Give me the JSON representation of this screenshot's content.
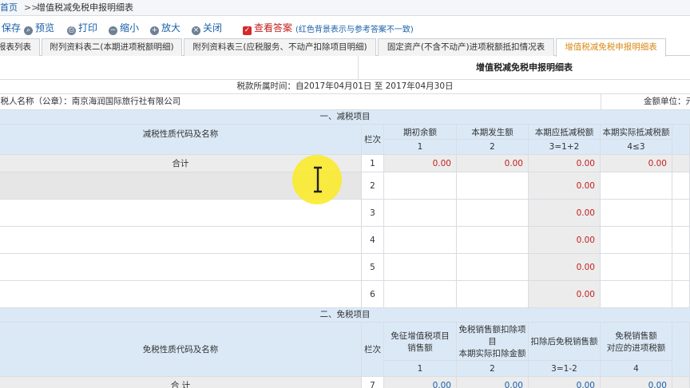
{
  "breadcrumb": {
    "home": "首页",
    "separator": ">>",
    "current": "增值税减免税申报明细表"
  },
  "toolbar": {
    "save": "保存",
    "preview": "预览",
    "print": "打印",
    "zoom_out": "缩小",
    "zoom_in": "放大",
    "close": "关闭",
    "answer": "查看答案",
    "answer_note": "(红色背景表示与参考答案不一致)"
  },
  "tabs": [
    {
      "label": "报表列表"
    },
    {
      "label": "附列资料表二(本期进项税额明细)"
    },
    {
      "label": "附列资料表三(应税服务、不动产扣除项目明细)"
    },
    {
      "label": "固定资产(不含不动产)进项税额抵扣情况表"
    },
    {
      "label": "增值税减免税申报明细表",
      "active": true
    }
  ],
  "form": {
    "title": "增值税减免税申报明细表",
    "period": "税款所属时间：自2017年04月01日 至 2017年04月30日",
    "payer": "纳税人名称（公章）：南京海润国际旅行社有限公司",
    "unit": "金额单位：元"
  },
  "section1": {
    "title": "一、减税项目",
    "col_name": "减税性质代码及名称",
    "col_seq": "栏次",
    "headers": [
      "期初余额",
      "本期发生额",
      "本期应抵减税额",
      "本期实际抵减税额"
    ],
    "codes": [
      "1",
      "2",
      "3=1+2",
      "4≤3"
    ],
    "total": {
      "label": "合计",
      "seq": "1",
      "values": [
        "0.00",
        "0.00",
        "0.00",
        "0.00"
      ]
    },
    "rows": [
      {
        "seq": "2",
        "value": "0.00"
      },
      {
        "seq": "3",
        "value": "0.00"
      },
      {
        "seq": "4",
        "value": "0.00"
      },
      {
        "seq": "5",
        "value": "0.00"
      },
      {
        "seq": "6",
        "value": "0.00"
      }
    ]
  },
  "section2": {
    "title": "二、免税项目",
    "col_name": "免税性质代码及名称",
    "col_seq": "栏次",
    "header1": "免征增值税项目销售额",
    "header2_line1": "免税销售额扣除项目",
    "header2_line2": "本期实际扣除金额",
    "header3": "扣除后免税销售额",
    "header4_line1": "免税销售额",
    "header4_line2": "对应的进项税额",
    "codes": [
      "1",
      "2",
      "3=1-2",
      "4"
    ],
    "total": {
      "label": "合 计",
      "seq": "7",
      "values": [
        "0.00",
        "0.00",
        "0.00",
        "0.00"
      ]
    }
  }
}
